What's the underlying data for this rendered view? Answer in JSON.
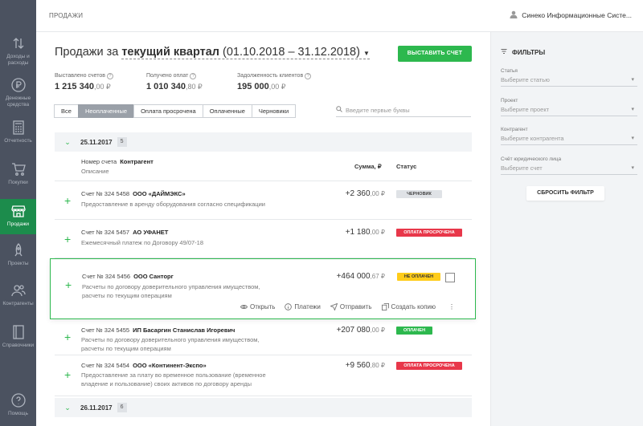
{
  "header": {
    "title": "ПРОДАЖИ",
    "user": "Синеко Информационные Систе..."
  },
  "sidebar": {
    "items": [
      {
        "label": "Доходы и расходы",
        "icon": "arrows-updown-icon"
      },
      {
        "label": "Денежные средства",
        "icon": "ruble-icon"
      },
      {
        "label": "Отчетность",
        "icon": "calculator-icon"
      },
      {
        "label": "Покупки",
        "icon": "cart-icon"
      },
      {
        "label": "Продажи",
        "icon": "store-icon"
      },
      {
        "label": "Проекты",
        "icon": "rocket-icon"
      },
      {
        "label": "Контрагенты",
        "icon": "contacts-icon"
      },
      {
        "label": "Справочники",
        "icon": "book-icon"
      },
      {
        "label": "Помощь",
        "icon": "help-icon"
      }
    ]
  },
  "page": {
    "heading_prefix": "Продажи за",
    "period": "текущий квартал",
    "dates": "(01.10.2018 – 31.12.2018)",
    "issue_button": "ВЫСТАВИТЬ СЧЕТ"
  },
  "stats": [
    {
      "label": "Выставлено счетов",
      "value": "1 215 340",
      "cents": ",00 ₽"
    },
    {
      "label": "Получено оплат",
      "value": "1 010 340",
      "cents": ",80 ₽"
    },
    {
      "label": "Задолженность клиентов",
      "value": "195 000",
      "cents": ",00 ₽"
    }
  ],
  "tabs": [
    "Все",
    "Неоплаченные",
    "Оплата просрочена",
    "Оплаченные",
    "Черновики"
  ],
  "search": {
    "placeholder": "Введите первые буквы"
  },
  "columns": {
    "number": "Номер счета",
    "counterparty": "Контрагент",
    "description": "Описание",
    "amount": "Сумма, ₽",
    "status": "Статус"
  },
  "groups": [
    {
      "date": "25.11.2017",
      "count": "5"
    },
    {
      "date": "26.11.2017",
      "count": "6"
    }
  ],
  "invoices": [
    {
      "number": "Счет № 324 5458",
      "company": "ООО «ДАЙМЭКС»",
      "desc": "Предоставление в аренду оборудования согласно спецификации",
      "amount": "+2 360",
      "cents": ",00 ₽",
      "status": "ЧЕРНОВИК"
    },
    {
      "number": "Счет № 324 5457",
      "company": "АО УФАНЕТ",
      "desc": "Ежемесячный платеж по Договору 49/07-18",
      "amount": "+1 180",
      "cents": ",00 ₽",
      "status": "ОПЛАТА ПРОСРОЧЕНА"
    },
    {
      "number": "Счет № 324 5456",
      "company": "ООО Санторг",
      "desc": "Расчеты по договору доверительного управления имуществом, расчеты по текущим операциям",
      "amount": "+464 000",
      "cents": ",67 ₽",
      "status": "НЕ ОПЛАЧЕН"
    },
    {
      "number": "Счет № 324 5455",
      "company": "ИП Басаргин Станислав Игоревич",
      "desc": "Расчеты по договору доверительного управления имуществом, расчеты по текущим операциям",
      "amount": "+207 080",
      "cents": ",00 ₽",
      "status": "ОПЛАЧЕН"
    },
    {
      "number": "Счет № 324 5454",
      "company": "ООО «Континент-Экспо»",
      "desc": "Предоставление за плату во временное пользование (временное владение и пользование) своих активов по договору аренды",
      "amount": "+9 560",
      "cents": ",80 ₽",
      "status": "ОПЛАТА ПРОСРОЧЕНА"
    }
  ],
  "actions": [
    "Открыть",
    "Платежи",
    "Отправить",
    "Создать копию"
  ],
  "filters": {
    "title": "ФИЛЬТРЫ",
    "fields": [
      {
        "label": "Статья",
        "placeholder": "Выберите статью"
      },
      {
        "label": "Проект",
        "placeholder": "Выберите проект"
      },
      {
        "label": "Контрагент",
        "placeholder": "Выберите контрагента"
      },
      {
        "label": "Счёт юридического лица",
        "placeholder": "Выберите счет"
      }
    ],
    "reset": "СБРОСИТЬ ФИЛЬТР"
  },
  "colors": {
    "accent": "#2db84e",
    "sidebar": "#4b5260",
    "active": "#1c8c4c",
    "danger": "#e8374a",
    "warning": "#ffcc1a"
  }
}
